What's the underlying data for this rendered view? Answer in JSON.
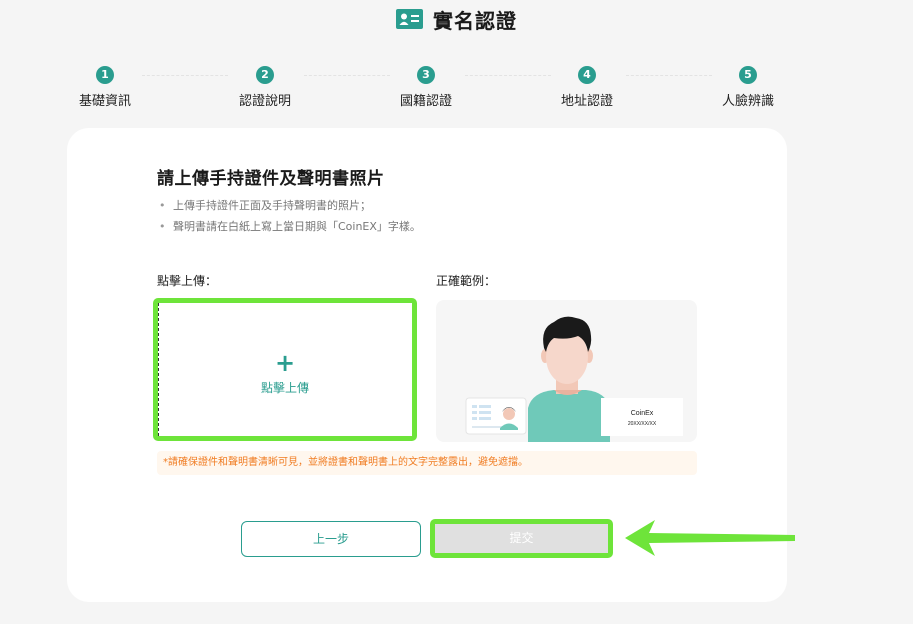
{
  "header": {
    "title": "實名認證",
    "icon": "id-card-icon"
  },
  "stepper": {
    "steps": [
      {
        "number": "1",
        "label": "基礎資訊"
      },
      {
        "number": "2",
        "label": "認證說明"
      },
      {
        "number": "3",
        "label": "國籍認證"
      },
      {
        "number": "4",
        "label": "地址認證"
      },
      {
        "number": "5",
        "label": "人臉辨識"
      }
    ]
  },
  "card": {
    "title": "請上傳手持證件及聲明書照片",
    "bullets": [
      "上傳手持證件正面及手持聲明書的照片；",
      "聲明書請在白紙上寫上當日期與「CoinEX」字樣。"
    ],
    "upload_label": "點擊上傳：",
    "upload_button_text": "點擊上傳",
    "example_label": "正確範例：",
    "example_note_brand": "CoinEx",
    "example_note_date": "20XX/XX/XX",
    "notice": "*請確保證件和聲明書清晰可見，並將證書和聲明書上的文字完整露出，避免遮擋。",
    "back_label": "上一步",
    "submit_label": "提交"
  },
  "colors": {
    "accent": "#2a9d8f",
    "highlight": "#6ee43a",
    "warning": "#f07c22",
    "notice_bg": "#fff7ee"
  }
}
